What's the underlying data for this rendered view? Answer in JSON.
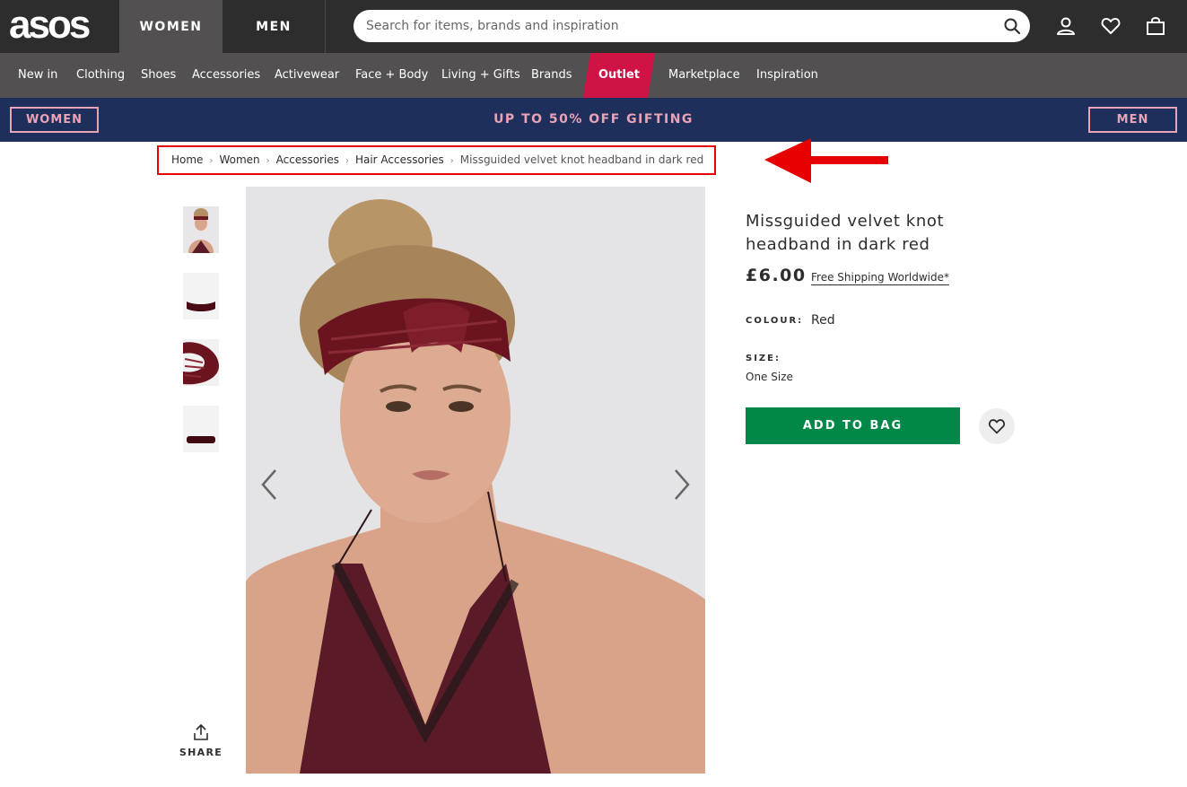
{
  "header": {
    "logo": "asos",
    "gender_tabs": [
      "WOMEN",
      "MEN"
    ],
    "search": {
      "placeholder": "Search for items, brands and inspiration"
    },
    "icons": [
      "search-icon",
      "account-icon",
      "saved-items-icon",
      "bag-icon"
    ]
  },
  "categories": [
    "New in",
    "Clothing",
    "Shoes",
    "Accessories",
    "Activewear",
    "Face + Body",
    "Living + Gifts",
    "Brands",
    "Outlet",
    "Marketplace",
    "Inspiration"
  ],
  "promo": {
    "left_button": "WOMEN",
    "text": "UP TO 50% OFF GIFTING",
    "right_button": "MEN"
  },
  "breadcrumb": [
    "Home",
    "Women",
    "Accessories",
    "Hair Accessories",
    "Missguided velvet knot headband in dark red"
  ],
  "gallery": {
    "share_label": "SHARE",
    "thumbnail_count": 4
  },
  "product": {
    "title": "Missguided velvet knot headband in dark red",
    "price": "£6.00",
    "shipping_link": "Free Shipping Worldwide*",
    "colour_label": "COLOUR:",
    "colour_value": "Red",
    "size_label": "SIZE:",
    "size_value": "One Size",
    "add_to_bag": "ADD TO BAG"
  },
  "colors": {
    "topbar": "#2d2d2d",
    "catnav": "#525050",
    "outlet": "#d01345",
    "promo_bg": "#1f2f5b",
    "promo_text": "#e9a3b6",
    "add_to_bag": "#018849",
    "annotation": "#e60000"
  }
}
